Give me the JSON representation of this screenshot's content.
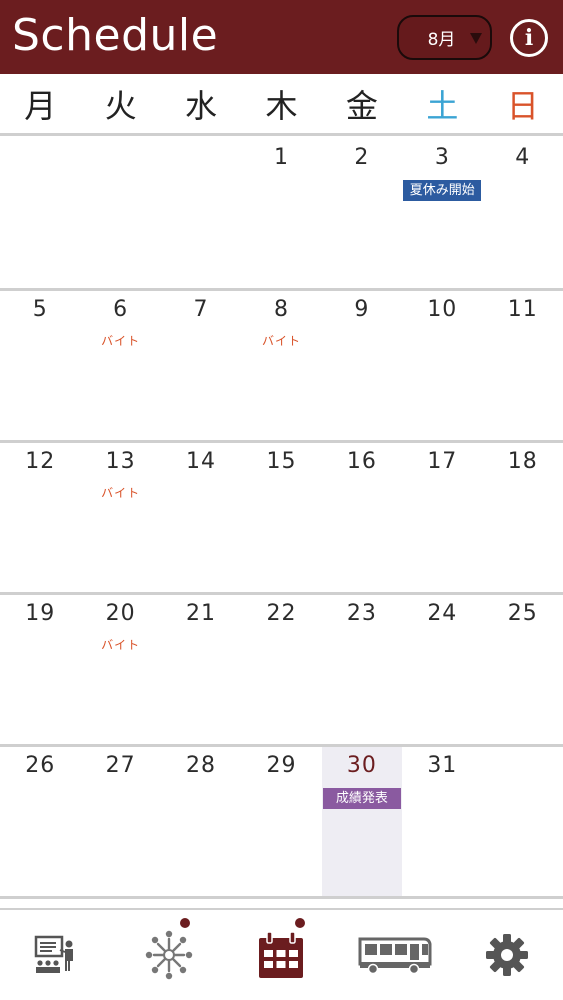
{
  "header": {
    "title": "Schedule",
    "month": "8月",
    "info_label": "i"
  },
  "weekdays": [
    {
      "label": "月",
      "color": "#222222"
    },
    {
      "label": "火",
      "color": "#222222"
    },
    {
      "label": "水",
      "color": "#222222"
    },
    {
      "label": "木",
      "color": "#222222"
    },
    {
      "label": "金",
      "color": "#222222"
    },
    {
      "label": "土",
      "color": "#3ba4d4"
    },
    {
      "label": "日",
      "color": "#d9532a"
    }
  ],
  "weeks": [
    [
      {
        "day": ""
      },
      {
        "day": ""
      },
      {
        "day": ""
      },
      {
        "day": "1"
      },
      {
        "day": "2"
      },
      {
        "day": "3",
        "event": "夏休み開始",
        "event_style": "tag blue"
      },
      {
        "day": "4"
      }
    ],
    [
      {
        "day": "5"
      },
      {
        "day": "6",
        "event": "バイト",
        "event_style": "text"
      },
      {
        "day": "7"
      },
      {
        "day": "8",
        "event": "バイト",
        "event_style": "text"
      },
      {
        "day": "9"
      },
      {
        "day": "10"
      },
      {
        "day": "11"
      }
    ],
    [
      {
        "day": "12"
      },
      {
        "day": "13",
        "event": "バイト",
        "event_style": "text"
      },
      {
        "day": "14"
      },
      {
        "day": "15"
      },
      {
        "day": "16"
      },
      {
        "day": "17"
      },
      {
        "day": "18"
      }
    ],
    [
      {
        "day": "19"
      },
      {
        "day": "20",
        "event": "バイト",
        "event_style": "text"
      },
      {
        "day": "21"
      },
      {
        "day": "22"
      },
      {
        "day": "23"
      },
      {
        "day": "24"
      },
      {
        "day": "25"
      }
    ],
    [
      {
        "day": "26"
      },
      {
        "day": "27"
      },
      {
        "day": "28"
      },
      {
        "day": "29"
      },
      {
        "day": "30",
        "event": "成績発表",
        "event_style": "tag purple",
        "today": true
      },
      {
        "day": "31"
      },
      {
        "day": ""
      }
    ]
  ],
  "bottom_nav": [
    {
      "name": "nav-classroom",
      "icon": "classroom-icon",
      "badge": false,
      "active": false
    },
    {
      "name": "nav-community",
      "icon": "community-icon",
      "badge": true,
      "active": false
    },
    {
      "name": "nav-schedule",
      "icon": "calendar-icon",
      "badge": true,
      "active": true
    },
    {
      "name": "nav-bus",
      "icon": "bus-icon",
      "badge": false,
      "active": false
    },
    {
      "name": "nav-settings",
      "icon": "gear-icon",
      "badge": false,
      "active": false
    }
  ],
  "colors": {
    "brand": "#6b1d1f",
    "saturday": "#3ba4d4",
    "sunday": "#d9532a",
    "event_text": "#d9532a",
    "tag_blue": "#2c5ba0",
    "tag_purple": "#8a5aa0",
    "today_bg": "#eeedf3",
    "icon_gray": "#555555"
  }
}
